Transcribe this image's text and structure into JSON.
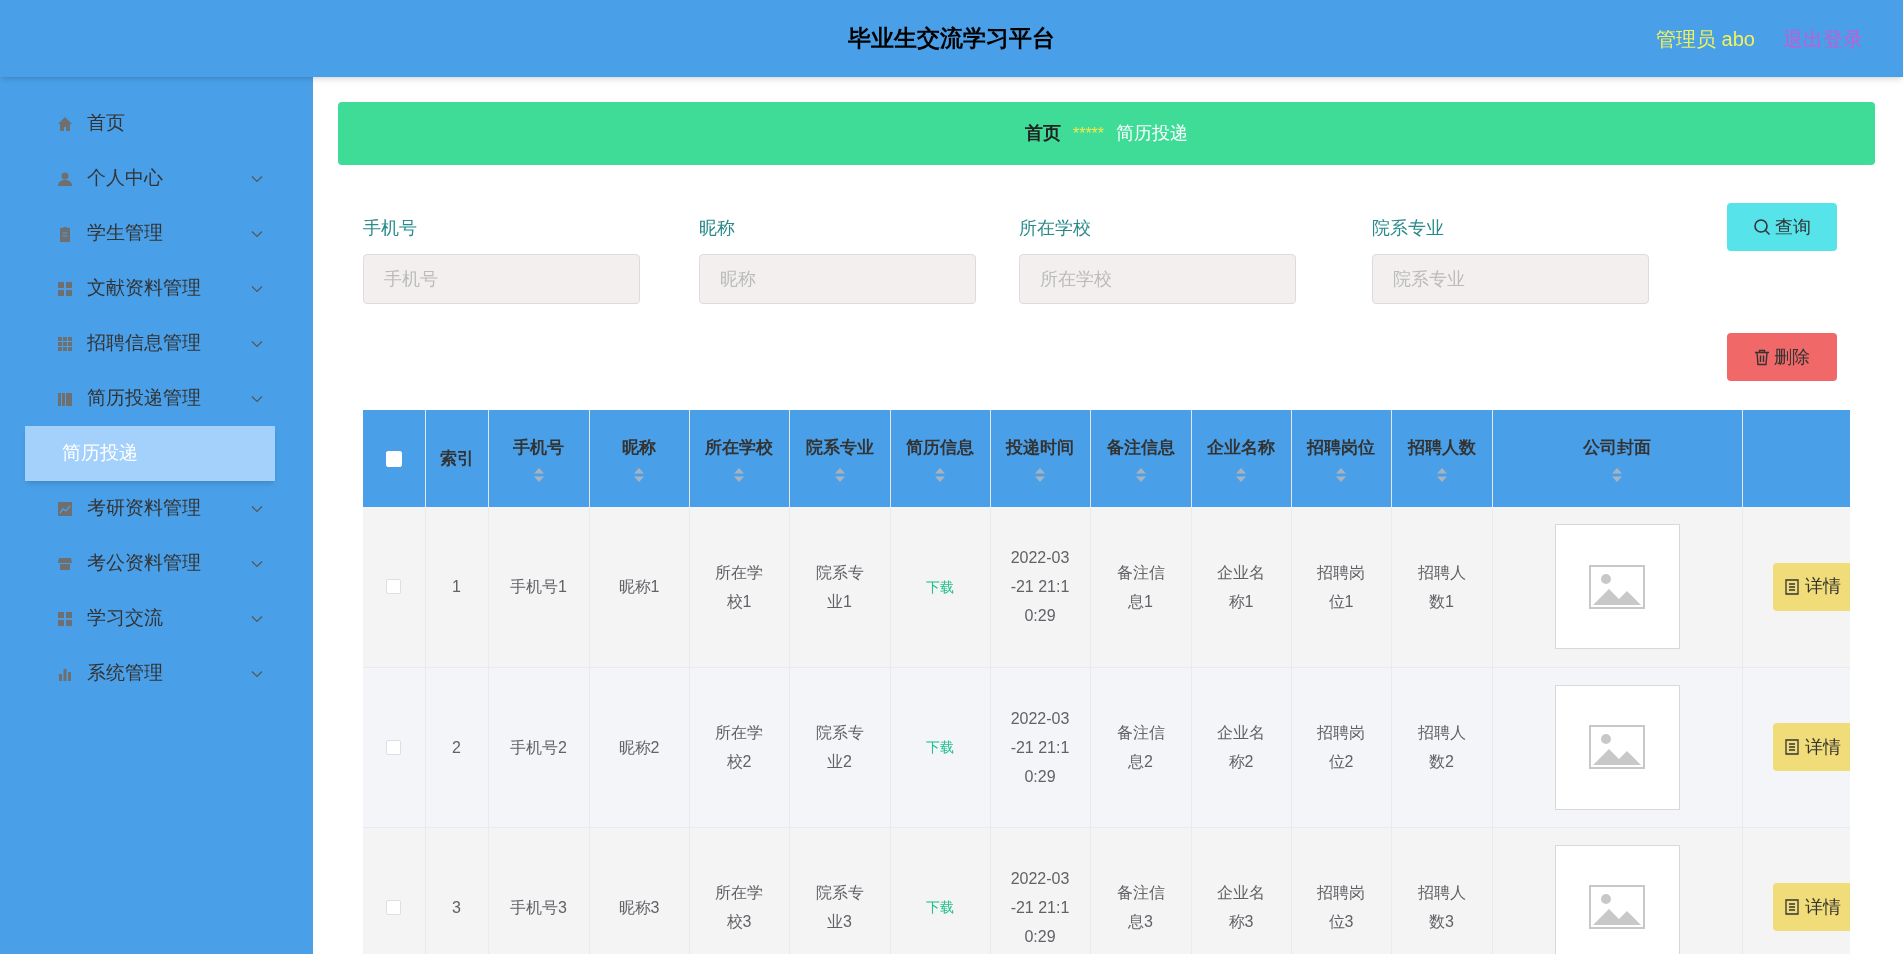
{
  "header": {
    "title": "毕业生交流学习平台",
    "user": "管理员 abo",
    "logout": "退出登录"
  },
  "sidebar": {
    "items": [
      {
        "label": "首页",
        "expandable": false
      },
      {
        "label": "个人中心",
        "expandable": true
      },
      {
        "label": "学生管理",
        "expandable": true
      },
      {
        "label": "文献资料管理",
        "expandable": true
      },
      {
        "label": "招聘信息管理",
        "expandable": true
      },
      {
        "label": "简历投递管理",
        "expandable": true,
        "children": [
          {
            "label": "简历投递",
            "selected": true
          }
        ]
      },
      {
        "label": "考研资料管理",
        "expandable": true
      },
      {
        "label": "考公资料管理",
        "expandable": true
      },
      {
        "label": "学习交流",
        "expandable": true
      },
      {
        "label": "系统管理",
        "expandable": true
      }
    ]
  },
  "breadcrumb": {
    "home": "首页",
    "separator": "*****",
    "current": "简历投递"
  },
  "search": {
    "fields": [
      {
        "label": "手机号",
        "placeholder": "手机号"
      },
      {
        "label": "昵称",
        "placeholder": "昵称"
      },
      {
        "label": "所在学校",
        "placeholder": "所在学校"
      },
      {
        "label": "院系专业",
        "placeholder": "院系专业"
      }
    ],
    "query_button": "查询",
    "delete_button": "删除"
  },
  "table": {
    "select_all_checked": false,
    "columns": [
      {
        "label": "索引",
        "sortable": false
      },
      {
        "label": "手机号",
        "sortable": true
      },
      {
        "label": "昵称",
        "sortable": true
      },
      {
        "label": "所在学校",
        "sortable": true
      },
      {
        "label": "院系专业",
        "sortable": true
      },
      {
        "label": "简历信息",
        "sortable": true
      },
      {
        "label": "投递时间",
        "sortable": true
      },
      {
        "label": "备注信息",
        "sortable": true
      },
      {
        "label": "企业名称",
        "sortable": true
      },
      {
        "label": "招聘岗位",
        "sortable": true
      },
      {
        "label": "招聘人数",
        "sortable": true
      },
      {
        "label": "公司封面",
        "sortable": true
      }
    ],
    "rows": [
      {
        "checked": false,
        "cells": [
          "1",
          "手机号1",
          "昵称1",
          "所在学校1",
          "院系专业1",
          "下载",
          "2022-03-21 21:10:29",
          "备注信息1",
          "企业名称1",
          "招聘岗位1",
          "招聘人数1"
        ],
        "action": "详情"
      },
      {
        "checked": false,
        "cells": [
          "2",
          "手机号2",
          "昵称2",
          "所在学校2",
          "院系专业2",
          "下载",
          "2022-03-21 21:10:29",
          "备注信息2",
          "企业名称2",
          "招聘岗位2",
          "招聘人数2"
        ],
        "action": "详情"
      },
      {
        "checked": false,
        "cells": [
          "3",
          "手机号3",
          "昵称3",
          "所在学校3",
          "院系专业3",
          "下载",
          "2022-03-21 21:10:29",
          "备注信息3",
          "企业名称3",
          "招聘岗位3",
          "招聘人数3"
        ],
        "action": "详情"
      }
    ]
  }
}
